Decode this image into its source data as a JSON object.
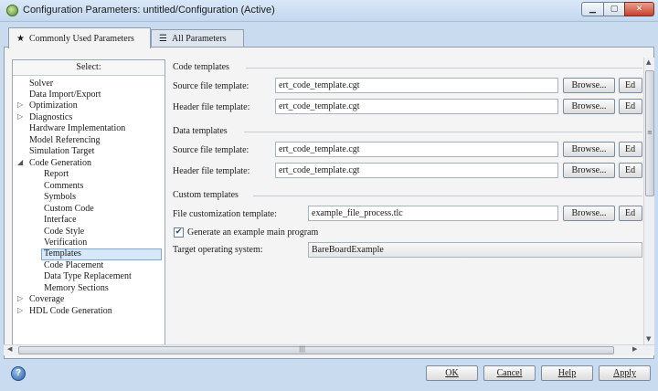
{
  "window": {
    "title": "Configuration Parameters: untitled/Configuration (Active)"
  },
  "tabs": [
    {
      "label": "Commonly Used Parameters",
      "icon": "star-icon",
      "active": true
    },
    {
      "label": "All Parameters",
      "icon": "list-icon",
      "active": false
    }
  ],
  "tree": {
    "header": "Select:",
    "items": [
      {
        "label": "Solver"
      },
      {
        "label": "Data Import/Export"
      },
      {
        "label": "Optimization",
        "expander": "collapsed"
      },
      {
        "label": "Diagnostics",
        "expander": "collapsed"
      },
      {
        "label": "Hardware Implementation"
      },
      {
        "label": "Model Referencing"
      },
      {
        "label": "Simulation Target"
      },
      {
        "label": "Code Generation",
        "expander": "expanded"
      },
      {
        "label": "Report"
      },
      {
        "label": "Comments"
      },
      {
        "label": "Symbols"
      },
      {
        "label": "Custom Code"
      },
      {
        "label": "Interface"
      },
      {
        "label": "Code Style"
      },
      {
        "label": "Verification"
      },
      {
        "label": "Templates",
        "selected": true
      },
      {
        "label": "Code Placement"
      },
      {
        "label": "Data Type Replacement"
      },
      {
        "label": "Memory Sections"
      },
      {
        "label": "Coverage",
        "expander": "collapsed"
      },
      {
        "label": "HDL Code Generation",
        "expander": "collapsed"
      }
    ]
  },
  "code_templates": {
    "title": "Code templates",
    "source_label": "Source file template:",
    "source_value": "ert_code_template.cgt",
    "header_label": "Header file template:",
    "header_value": "ert_code_template.cgt"
  },
  "data_templates": {
    "title": "Data templates",
    "source_label": "Source file template:",
    "source_value": "ert_code_template.cgt",
    "header_label": "Header file template:",
    "header_value": "ert_code_template.cgt"
  },
  "custom_templates": {
    "title": "Custom templates",
    "file_label": "File customization template:",
    "file_value": "example_file_process.tlc",
    "generate_main_label": "Generate an example main program",
    "generate_main_checked": true,
    "check_mark": "✔",
    "target_os_label": "Target operating system:",
    "target_os_value": "BareBoardExample"
  },
  "buttons": {
    "browse": "Browse...",
    "edit": "Ed"
  },
  "scroll": {
    "grip": "|||"
  },
  "footer": {
    "help": "?",
    "ok": "OK",
    "cancel": "Cancel",
    "help_button": "Help",
    "apply": "Apply"
  },
  "colors": {
    "window_chrome": "#c9dbef",
    "selection": "#d6e8fa",
    "close_button": "#c8402a"
  }
}
